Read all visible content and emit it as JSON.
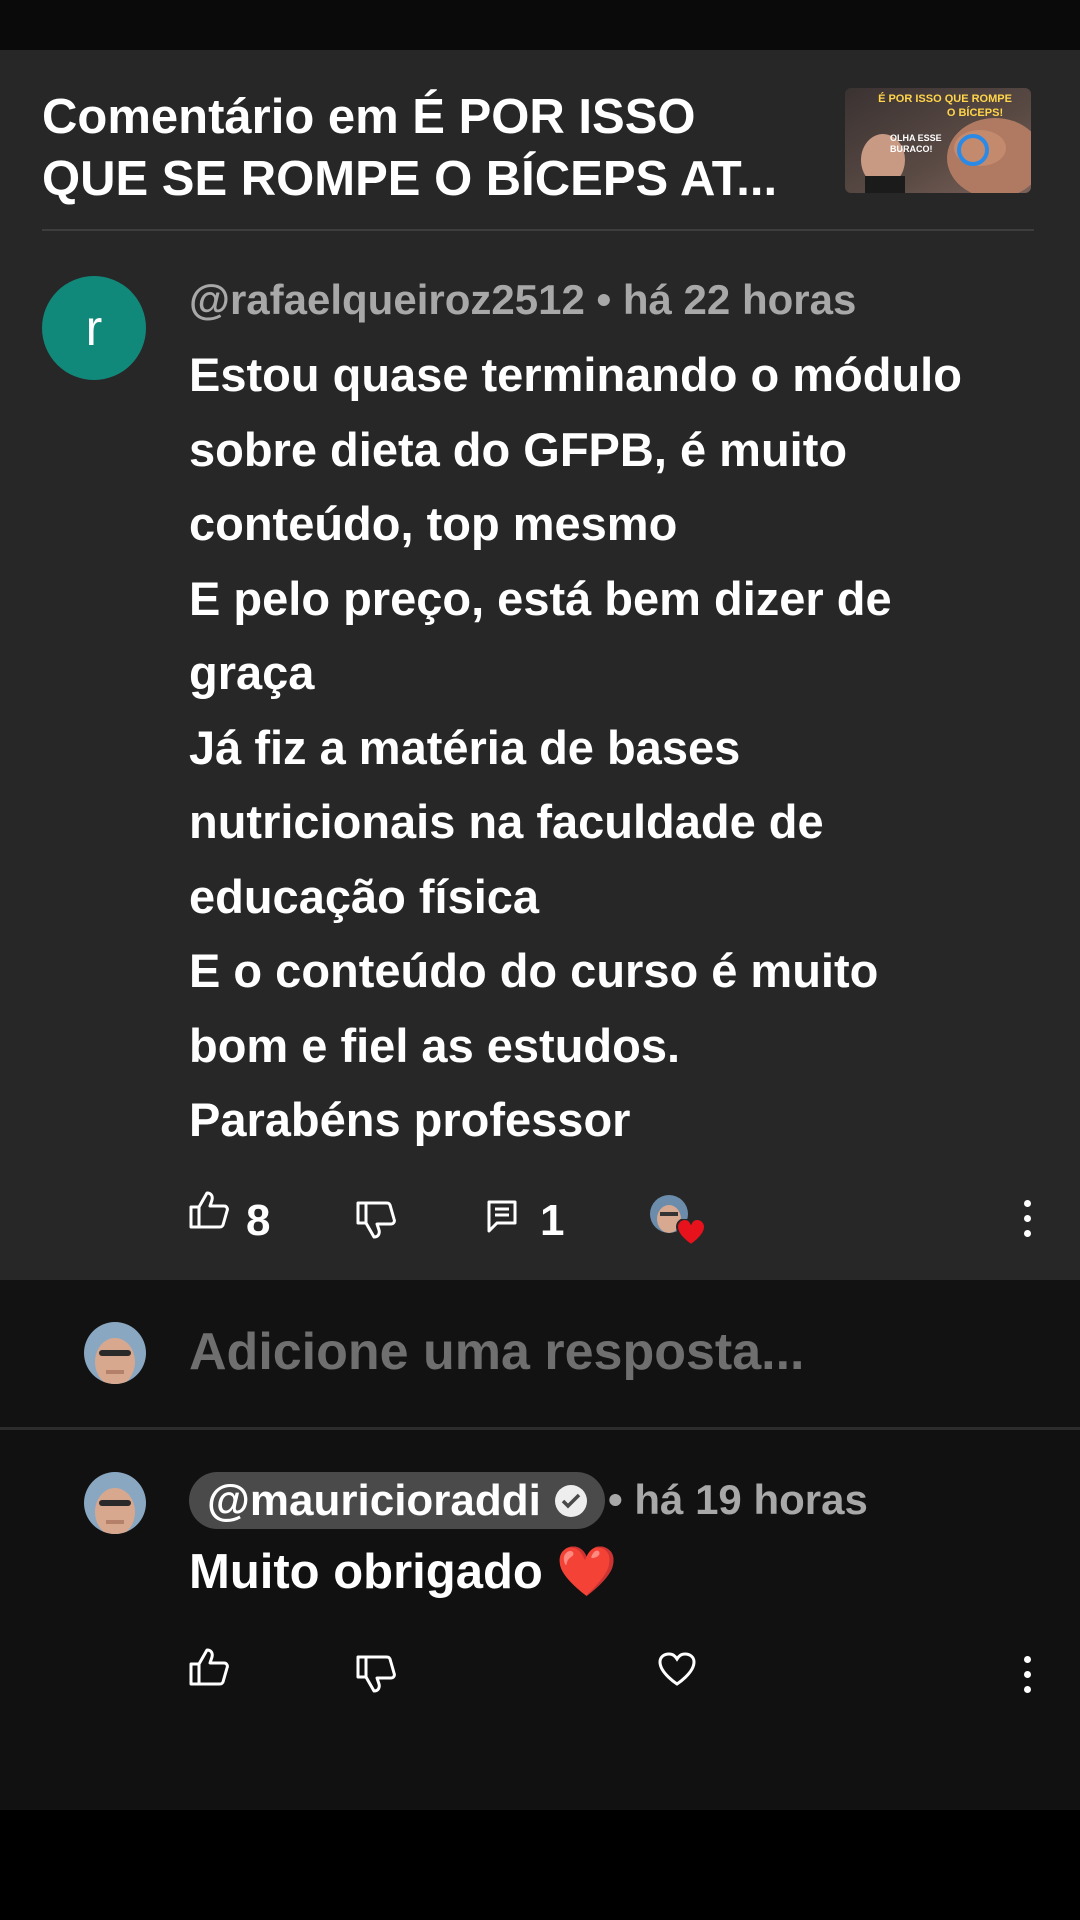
{
  "header": {
    "title": "Comentário em É POR ISSO QUE SE ROMPE O BÍCEPS AT...",
    "thumbnail": {
      "line1": "É POR ISSO QUE ROMPE",
      "line2": "O BÍCEPS!",
      "badge1": "OLHA ESSE",
      "badge2": "BURACO!"
    }
  },
  "comment": {
    "avatar_letter": "r",
    "author": "@rafaelqueiroz2512",
    "time": "há 22 horas",
    "separator": "•",
    "lines": [
      "Estou quase terminando o módulo",
      "sobre dieta do GFPB, é muito",
      "conteúdo, top mesmo",
      "E pelo preço, está bem dizer de",
      "graça",
      "Já fiz a matéria de bases",
      "nutricionais na faculdade de",
      "educação física",
      "E o conteúdo do curso é muito",
      "bom e fiel as estudos.",
      "Parabéns professor"
    ],
    "likes": "8",
    "replies": "1"
  },
  "reply_box": {
    "placeholder": "Adicione uma resposta..."
  },
  "reply": {
    "author": "@mauricioraddi",
    "time": "há 19 horas",
    "separator": "•",
    "text": "Muito obrigado ❤️"
  },
  "colors": {
    "avatar_bg": "#11897a",
    "heart": "#e8121d",
    "panel": "#272727"
  }
}
